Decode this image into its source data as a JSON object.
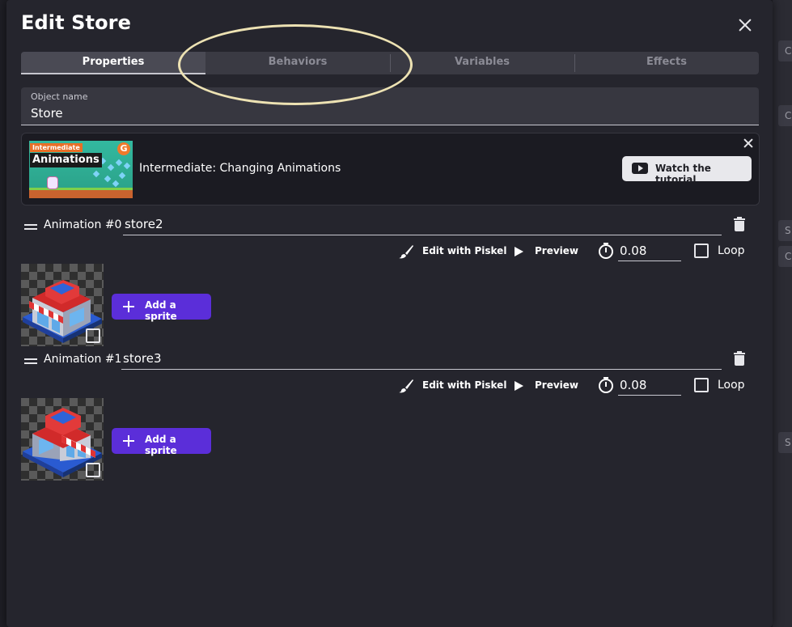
{
  "dialog": {
    "title": "Edit Store",
    "tabs": [
      "Properties",
      "Behaviors",
      "Variables",
      "Effects"
    ],
    "active_tab": "Properties"
  },
  "object_name": {
    "label": "Object name",
    "value": "Store"
  },
  "tutorial": {
    "thumbnail_tag": "Intermediate",
    "thumbnail_word": "Animations",
    "title": "Intermediate: Changing Animations",
    "watch_label": "Watch the tutorial"
  },
  "animations": [
    {
      "label": "Animation #0",
      "name": "store2",
      "edit_label": "Edit with Piskel",
      "preview_label": "Preview",
      "speed": "0.08",
      "loop_label": "Loop",
      "add_sprite_label": "Add a sprite"
    },
    {
      "label": "Animation #1",
      "name": "store3",
      "edit_label": "Edit with Piskel",
      "preview_label": "Preview",
      "speed": "0.08",
      "loop_label": "Loop",
      "add_sprite_label": "Add a sprite"
    }
  ],
  "background": {
    "fragments": [
      "C",
      "C",
      "S",
      "C",
      "S"
    ]
  },
  "icons": {
    "close": "close-icon",
    "drag": "drag-handle-icon",
    "brush": "brush-icon",
    "play": "play-icon",
    "timer": "timer-icon",
    "trash": "trash-icon",
    "youtube": "youtube-icon",
    "plus": "plus-icon"
  },
  "colors": {
    "dialog_bg": "#25252d",
    "accent": "#5b2ed9",
    "annotation": "#ede2b3"
  }
}
